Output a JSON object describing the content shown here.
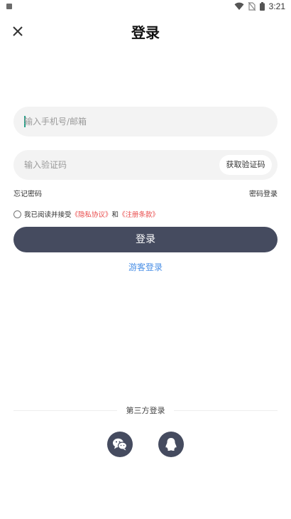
{
  "status_bar": {
    "time": "3:21",
    "icons": [
      "notification-icon",
      "wifi-icon",
      "no-sim-icon",
      "battery-icon"
    ]
  },
  "header": {
    "title": "登录",
    "close_icon": "close-icon"
  },
  "form": {
    "phone_placeholder": "输入手机号/邮箱",
    "phone_value": "",
    "code_placeholder": "输入验证码",
    "code_value": "",
    "get_code_label": "获取验证码"
  },
  "links": {
    "forgot_password": "忘记密码",
    "password_login": "密码登录"
  },
  "agreement": {
    "checked": false,
    "prefix": "我已阅读并接受",
    "privacy": "《隐私协议》",
    "and": "和",
    "terms": "《注册条款》"
  },
  "login_button": "登录",
  "guest_login": "游客登录",
  "third_party": {
    "label": "第三方登录",
    "providers": [
      "wechat-icon",
      "qq-icon"
    ]
  },
  "colors": {
    "primary": "#454b5f",
    "link_blue": "#4a8fe6",
    "link_red": "#e94a4a",
    "field_bg": "#f3f3f3"
  }
}
